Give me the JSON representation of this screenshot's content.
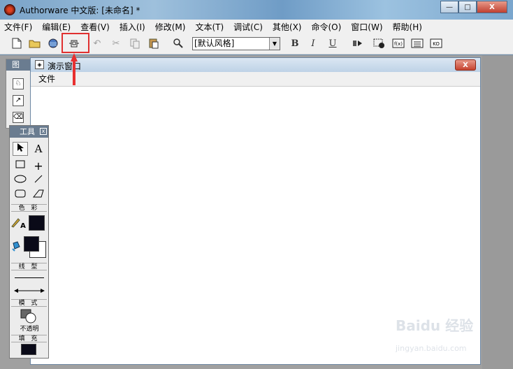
{
  "window": {
    "title": "Authorware 中文版: [未命名] *",
    "minimize": "—",
    "maximize": "□",
    "close": "X"
  },
  "menubar": {
    "items": [
      "文件(F)",
      "编辑(E)",
      "查看(V)",
      "插入(I)",
      "修改(M)",
      "文本(T)",
      "调试(C)",
      "其他(X)",
      "命令(O)",
      "窗口(W)",
      "帮助(H)"
    ]
  },
  "toolbar": {
    "style_select": "[默认风格]",
    "bold": "B",
    "italic": "I",
    "underline": "U",
    "highlight_color": "#e03030"
  },
  "icon_palette": {
    "title": "图"
  },
  "presentation_window": {
    "title": "演示窗口",
    "close": "X",
    "menu": "文件"
  },
  "tools": {
    "title": "工具",
    "close": "x",
    "color_label": "色 彩",
    "line_label": "线 型",
    "mode_label": "模 式",
    "mode_value": "不透明",
    "fill_label": "填 充",
    "text_tool": "A",
    "text_color_tool": "A"
  },
  "watermark": {
    "brand": "Baidu 经验",
    "url": "jingyan.baidu.com"
  }
}
